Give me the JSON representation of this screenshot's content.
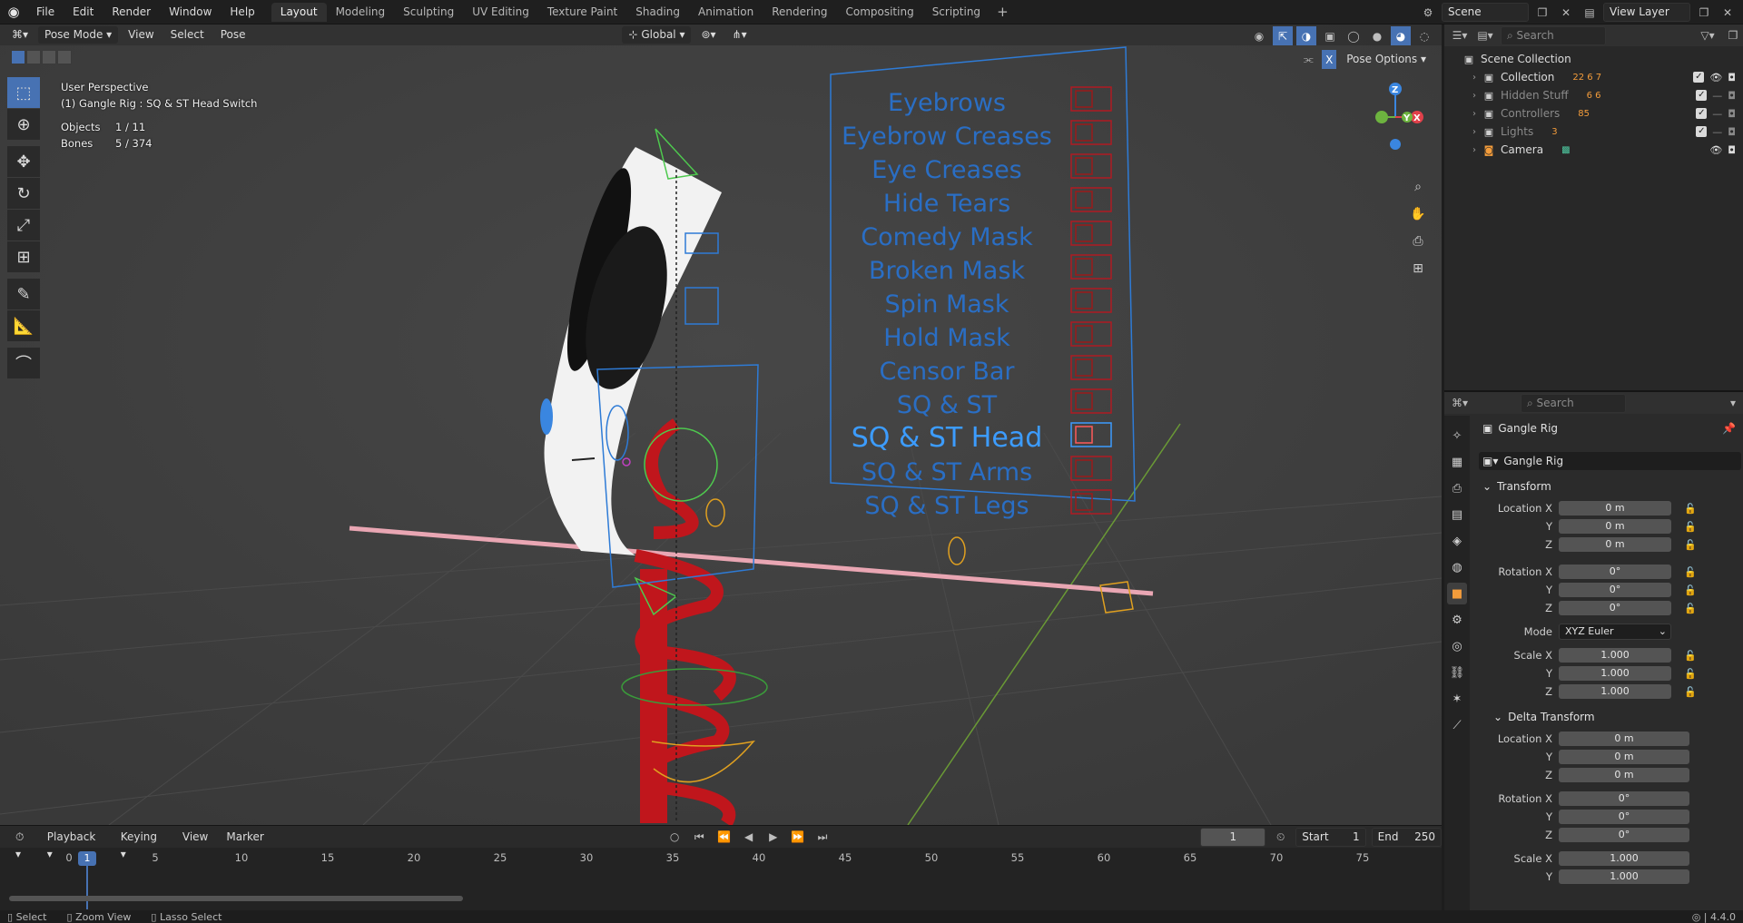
{
  "menubar": {
    "items": [
      "File",
      "Edit",
      "Render",
      "Window",
      "Help"
    ]
  },
  "workspaces": {
    "tabs": [
      "Layout",
      "Modeling",
      "Sculpting",
      "UV Editing",
      "Texture Paint",
      "Shading",
      "Animation",
      "Rendering",
      "Compositing",
      "Scripting"
    ],
    "active": "Layout",
    "add": "+"
  },
  "topright": {
    "scene": "Scene",
    "view_layer": "View Layer"
  },
  "viewport": {
    "mode": "Pose Mode",
    "menus": [
      "View",
      "Select",
      "Pose"
    ],
    "transform_orientation": "Global",
    "pose_options": "Pose Options",
    "info": {
      "perspective": "User Perspective",
      "active": "(1) Gangle Rig : SQ & ST Head Switch",
      "objects_label": "Objects",
      "objects_value": "1 / 11",
      "bones_label": "Bones",
      "bones_value": "5 / 374"
    },
    "controller_labels": [
      "Eyebrows",
      "Eyebrow Creases",
      "Eye Creases",
      "Hide Tears",
      "Comedy Mask",
      "Broken Mask",
      "Spin Mask",
      "Hold Mask",
      "Censor Bar",
      "SQ & ST",
      "SQ & ST Head",
      "SQ & ST Arms",
      "SQ & ST Legs"
    ],
    "gizmo": {
      "z": "Z",
      "y": "Y",
      "x": "X"
    }
  },
  "timeline": {
    "menus": [
      "Playback",
      "Keying",
      "View",
      "Marker"
    ],
    "current_frame": "1",
    "start_label": "Start",
    "start": "1",
    "end_label": "End",
    "end": "250",
    "ticks": [
      "0",
      "5",
      "10",
      "15",
      "20",
      "25",
      "30",
      "35",
      "40",
      "45",
      "50",
      "55",
      "60",
      "65",
      "70",
      "75"
    ],
    "playhead": "1"
  },
  "statusbar": {
    "select": "Select",
    "zoom": "Zoom View",
    "lasso": "Lasso Select",
    "version": "4.4.0"
  },
  "outliner": {
    "search_placeholder": "Search",
    "root": "Scene Collection",
    "items": [
      {
        "name": "Collection",
        "badge": "22  6  7"
      },
      {
        "name": "Hidden Stuff",
        "badge": "6  6"
      },
      {
        "name": "Controllers",
        "badge": "85"
      },
      {
        "name": "Lights",
        "badge": "3"
      },
      {
        "name": "Camera",
        "badge": ""
      }
    ]
  },
  "properties": {
    "search_placeholder": "Search",
    "object_name": "Gangle Rig",
    "datablock": "Gangle Rig",
    "transform_label": "Transform",
    "location_x_label": "Location X",
    "location_x": "0 m",
    "location_y_label": "Y",
    "location_y": "0 m",
    "location_z_label": "Z",
    "location_z": "0 m",
    "rotation_x_label": "Rotation X",
    "rotation_x": "0°",
    "rotation_y_label": "Y",
    "rotation_y": "0°",
    "rotation_z_label": "Z",
    "rotation_z": "0°",
    "mode_label": "Mode",
    "mode": "XYZ Euler",
    "scale_x_label": "Scale X",
    "scale_x": "1.000",
    "scale_y_label": "Y",
    "scale_y": "1.000",
    "scale_z_label": "Z",
    "scale_z": "1.000",
    "delta_label": "Delta Transform",
    "d_location_x_label": "Location X",
    "d_location_x": "0 m",
    "d_location_y_label": "Y",
    "d_location_y": "0 m",
    "d_location_z_label": "Z",
    "d_location_z": "0 m",
    "d_rotation_x_label": "Rotation X",
    "d_rotation_x": "0°",
    "d_rotation_y_label": "Y",
    "d_rotation_y": "0°",
    "d_rotation_z_label": "Z",
    "d_rotation_z": "0°",
    "d_scale_x_label": "Scale X",
    "d_scale_x": "1.000",
    "d_scale_y_label": "Y",
    "d_scale_y": "1.000"
  },
  "colors": {
    "accent": "#4772b3",
    "controller_blue": "#2e7bd6",
    "rig_red": "#c0161c",
    "bone_green": "#4ec94e",
    "axis_x": "#e0404a",
    "axis_y": "#6db33f",
    "axis_z": "#3a86e0"
  }
}
